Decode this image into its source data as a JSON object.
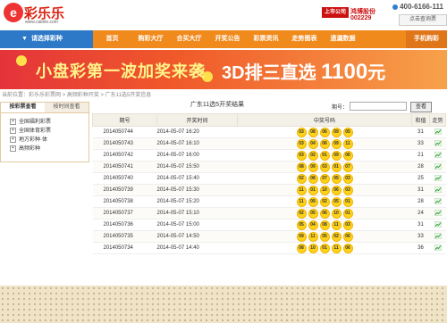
{
  "header": {
    "logo_text": "彩乐乐",
    "logo_mark": "e",
    "logo_url": "www.cailele.com",
    "listed_tag": "上市公司",
    "listed_name": "鸿博股份",
    "listed_code": "002229",
    "phone": "400-6166-111",
    "query_label": "点击查询票"
  },
  "nav": {
    "select_label": "请选择彩种",
    "items": [
      "首页",
      "购彩大厅",
      "合买大厅",
      "开奖公告",
      "彩票资讯",
      "走势图表",
      "遗漏数据"
    ],
    "mobile_label": "手机购彩"
  },
  "banner": {
    "left_text": "小盘彩第一波加奖来袭",
    "right_text": "3D排三直选",
    "amount": "1100",
    "unit": "元"
  },
  "breadcrumb": "当前位置：彩乐乐彩票网 > 高频彩种开奖 > 广东11选5开奖信息",
  "sidebar": {
    "tabs": [
      "按彩票查看",
      "按时间查看"
    ],
    "active_tab": 0,
    "items": [
      "全国福利彩票",
      "全国体育彩票",
      "地方彩种·体",
      "高频彩种"
    ]
  },
  "main": {
    "title": "广东11选5开奖结果",
    "issue_label": "期号：",
    "issue_value": "",
    "view_button": "查看",
    "columns": [
      "期号",
      "开奖时间",
      "中奖号码",
      "和值",
      "走势"
    ],
    "rows": [
      {
        "issue": "2014050744",
        "time": "2014-05-07 16:20",
        "nums": [
          "03",
          "08",
          "06",
          "09",
          "05"
        ],
        "sum": "31"
      },
      {
        "issue": "2014050743",
        "time": "2014-05-07 16:10",
        "nums": [
          "03",
          "04",
          "06",
          "09",
          "11"
        ],
        "sum": "33"
      },
      {
        "issue": "2014050742",
        "time": "2014-05-07 16:00",
        "nums": [
          "03",
          "02",
          "01",
          "09",
          "06"
        ],
        "sum": "21"
      },
      {
        "issue": "2014050741",
        "time": "2014-05-07 15:50",
        "nums": [
          "08",
          "09",
          "03",
          "01",
          "07"
        ],
        "sum": "28"
      },
      {
        "issue": "2014050740",
        "time": "2014-05-07 15:40",
        "nums": [
          "02",
          "08",
          "07",
          "05",
          "03"
        ],
        "sum": "25"
      },
      {
        "issue": "2014050739",
        "time": "2014-05-07 15:30",
        "nums": [
          "11",
          "01",
          "10",
          "06",
          "03"
        ],
        "sum": "31"
      },
      {
        "issue": "2014050738",
        "time": "2014-05-07 15:20",
        "nums": [
          "11",
          "09",
          "02",
          "05",
          "01"
        ],
        "sum": "28"
      },
      {
        "issue": "2014050737",
        "time": "2014-05-07 15:10",
        "nums": [
          "02",
          "05",
          "06",
          "10",
          "01"
        ],
        "sum": "24"
      },
      {
        "issue": "2014050736",
        "time": "2014-05-07 15:00",
        "nums": [
          "05",
          "04",
          "08",
          "11",
          "03"
        ],
        "sum": "31"
      },
      {
        "issue": "2014050735",
        "time": "2014-05-07 14:50",
        "nums": [
          "09",
          "11",
          "05",
          "02",
          "06"
        ],
        "sum": "33"
      },
      {
        "issue": "2014050734",
        "time": "2014-05-07 14:40",
        "nums": [
          "08",
          "10",
          "01",
          "11",
          "06"
        ],
        "sum": "36"
      }
    ]
  },
  "colors": {
    "nav_orange": "#f08a1c",
    "select_blue": "#2d79c7",
    "ball_yellow": "#ffd21a",
    "brand_red": "#d21"
  }
}
